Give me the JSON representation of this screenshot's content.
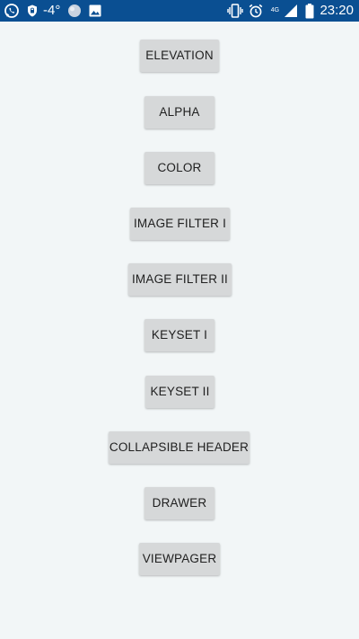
{
  "status_bar": {
    "temperature": "-4°",
    "network_label": "4G",
    "time": "23:20",
    "icons": [
      "whatsapp-icon",
      "shield-icon",
      "weather-icon",
      "image-icon",
      "vibrate-icon",
      "alarm-icon",
      "signal-icon",
      "battery-icon"
    ],
    "background_color": "#0a4f92"
  },
  "buttons": {
    "elevation": "ELEVATION",
    "alpha": "ALPHA",
    "color": "COLOR",
    "image_filter_1": "IMAGE FILTER I",
    "image_filter_2": "IMAGE FILTER II",
    "keyset_1": "KEYSET I",
    "keyset_2": "KEYSET II",
    "collapsible_header": "COLLAPSIBLE HEADER",
    "drawer": "DRAWER",
    "viewpager": "VIEWPAGER"
  },
  "theme": {
    "background": "#f2f6f7",
    "button_background": "#d6d8d9",
    "button_text": "#202020"
  }
}
